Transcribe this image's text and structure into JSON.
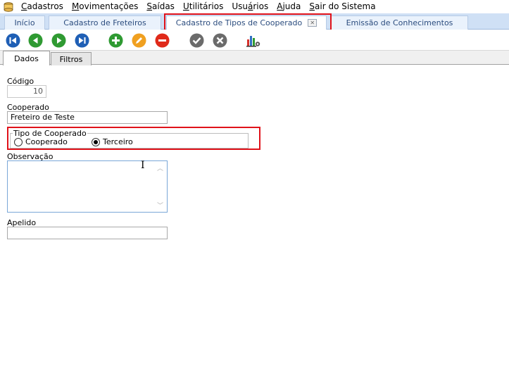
{
  "menu": {
    "items": [
      {
        "mnemonic": "C",
        "rest": "adastros"
      },
      {
        "mnemonic": "M",
        "rest": "ovimentações"
      },
      {
        "mnemonic": "S",
        "rest": "aídas"
      },
      {
        "mnemonic": "U",
        "rest": "tilitários"
      },
      {
        "pre": "Usu",
        "mnemonic": "á",
        "rest": "rios"
      },
      {
        "mnemonic": "A",
        "rest": "juda"
      },
      {
        "mnemonic": "S",
        "rest": "air do Sistema"
      }
    ]
  },
  "tabs": [
    {
      "label": "Início"
    },
    {
      "label": "Cadastro de Freteiros"
    },
    {
      "label": "Cadastro de Tipos de Cooperado",
      "active": true,
      "closable": true
    },
    {
      "label": "Emissão de Conhecimentos"
    }
  ],
  "toolbar": {
    "icons": [
      "first-record-icon",
      "previous-record-icon",
      "next-record-icon",
      "last-record-icon",
      "add-icon",
      "edit-icon",
      "delete-icon",
      "confirm-icon",
      "cancel-icon",
      "report-chart-icon"
    ]
  },
  "inner_tabs": [
    {
      "label": "Dados",
      "active": true
    },
    {
      "label": "Filtros"
    }
  ],
  "form": {
    "codigo_label": "Código",
    "codigo_value": "10",
    "cooperado_label": "Cooperado",
    "cooperado_value": "Freteiro de Teste",
    "tipo_label": "Tipo de Cooperado",
    "tipo_options": [
      {
        "label": "Cooperado",
        "selected": false
      },
      {
        "label": "Terceiro",
        "selected": true
      }
    ],
    "observacao_label": "Observação",
    "observacao_value": "",
    "apelido_label": "Apelido",
    "apelido_value": ""
  },
  "colors": {
    "highlight": "#e0121a",
    "nav_blue": "#1f5fb5",
    "add_green": "#2f9a32",
    "edit_orange": "#f0a020",
    "delete_red": "#e02a1a",
    "confirm_gray": "#6b6b6b"
  }
}
